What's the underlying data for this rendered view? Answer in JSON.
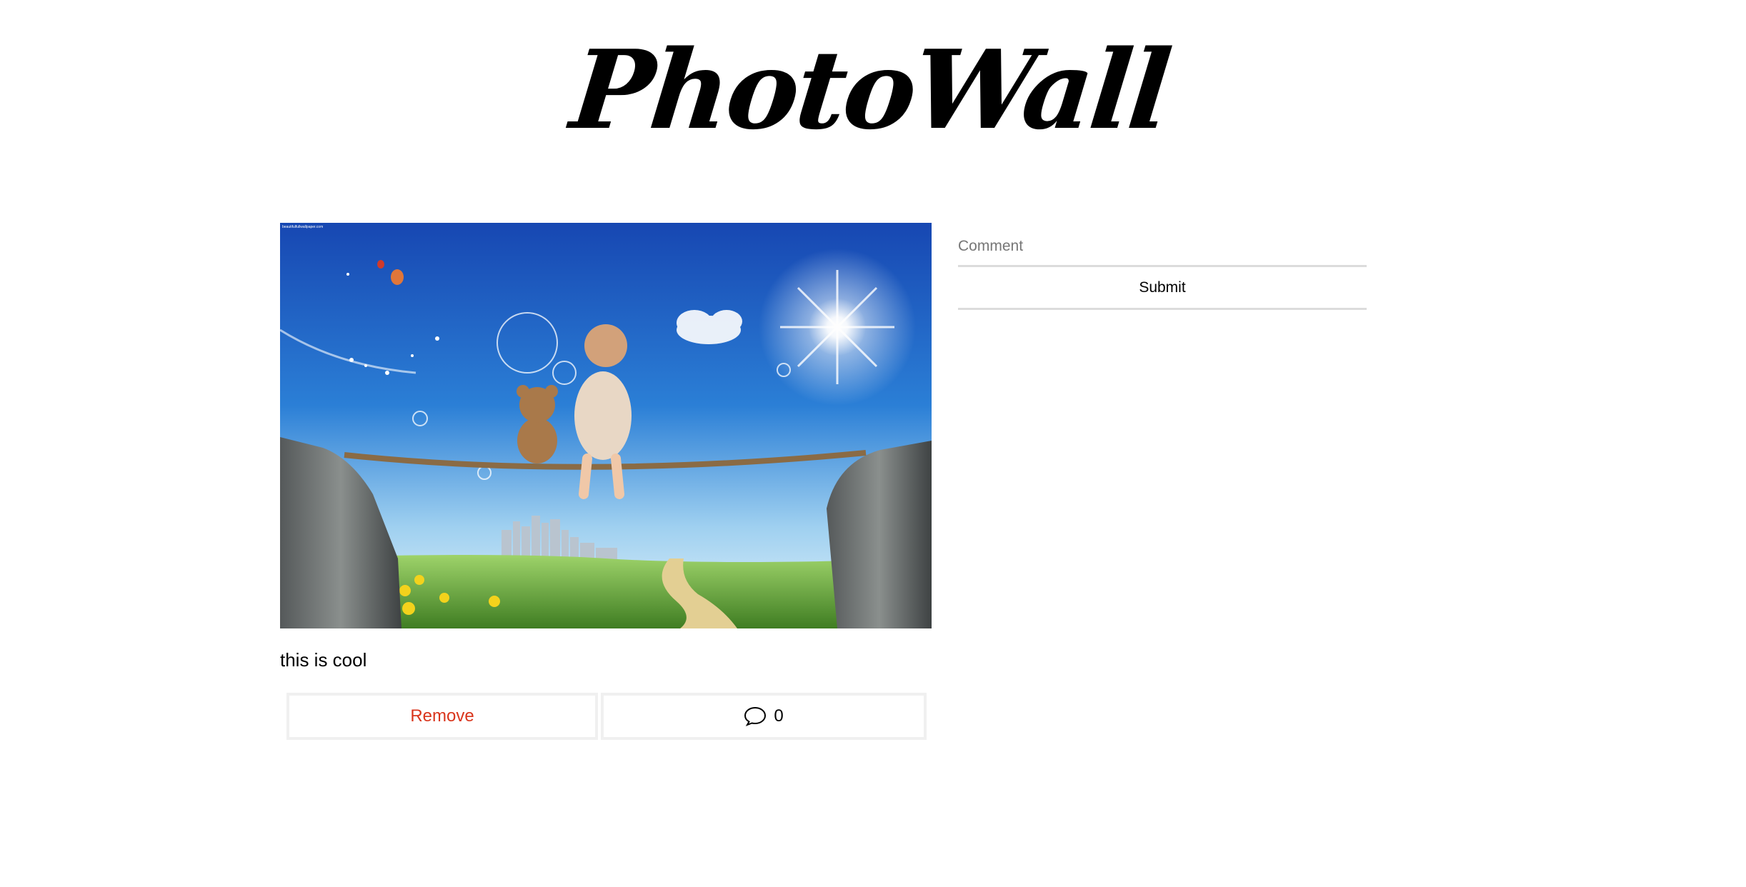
{
  "header": {
    "title": "PhotoWall"
  },
  "post": {
    "image_alt": "Child and teddy bear sitting on a plank between two rocks, looking at a city under a blue sky",
    "image_watermark": "beautifulfullwallpaper.com",
    "caption": "this is cool",
    "remove_label": "Remove",
    "comment_icon": "speech-bubble-icon",
    "comment_count": "0"
  },
  "comment_form": {
    "placeholder": "Comment",
    "value": "",
    "submit_label": "Submit"
  },
  "colors": {
    "remove_text": "#d9351c",
    "button_border": "#f0f0f0",
    "input_underline": "#dcdcdc",
    "sky_top": "#1747b2",
    "sky_bottom": "#d6ecf8",
    "grass": "#4a8b2a"
  }
}
